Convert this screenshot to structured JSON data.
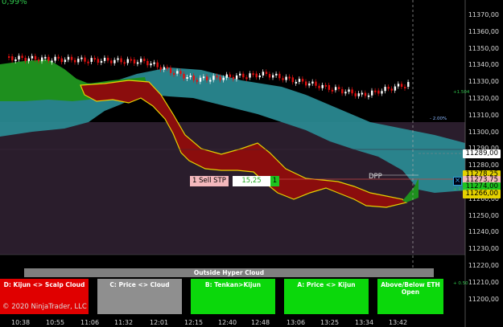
{
  "top_percent": "0,99%",
  "price_axis": [
    "11370,00",
    "11360,00",
    "11350,00",
    "11340,00",
    "11330,00",
    "11320,00",
    "11310,00",
    "11300,00",
    "11290,00",
    "11280,00",
    "11270,00",
    "11260,00",
    "11250,00",
    "11240,00",
    "11230,00",
    "11220,00",
    "11210,00",
    "11200,00"
  ],
  "price_tags": {
    "p1": "11289,00",
    "p2": "11273,75",
    "p3": "11266,00",
    "p_hidden_1": "11278,25",
    "p_hidden_2": "11274,00"
  },
  "side_notes": {
    "plus1504": "+1.504",
    "minus200": "- 2.00%",
    "plus100": "+ 1.00",
    "plus050": "+ 0.50"
  },
  "time_axis": [
    "10:38",
    "10:55",
    "11:06",
    "11:32",
    "12:01",
    "12:15",
    "12:40",
    "12:48",
    "13:06",
    "13:25",
    "13:34",
    "13:42"
  ],
  "order": {
    "label": "1 Sell STP",
    "qty": "15,25",
    "count": "1"
  },
  "dpp_label": "DPP",
  "hyper_label": "Outside Hyper Cloud",
  "status_segments": [
    {
      "label": "D: Kijun <> Scalp Cloud",
      "color": "#e00000"
    },
    {
      "label": "C: Price <> Cloud",
      "color": "#8f8f8f"
    },
    {
      "label": "B: Tenkan>Kijun",
      "color": "#0bd80b"
    },
    {
      "label": "A: Price <> Kijun",
      "color": "#0bd80b"
    },
    {
      "label": "Above/Below ETH Open",
      "color": "#0bd80b"
    }
  ],
  "copyright": "© 2020 NinjaTrader, LLC",
  "colors": {
    "cloud": "#2a8c95",
    "bull_cloud": "#1e8f1e",
    "bear_cloud": "#8b0d0d",
    "up_candle": "#ffffff",
    "down_candle": "#e01010",
    "band": "#2a1d2c"
  }
}
